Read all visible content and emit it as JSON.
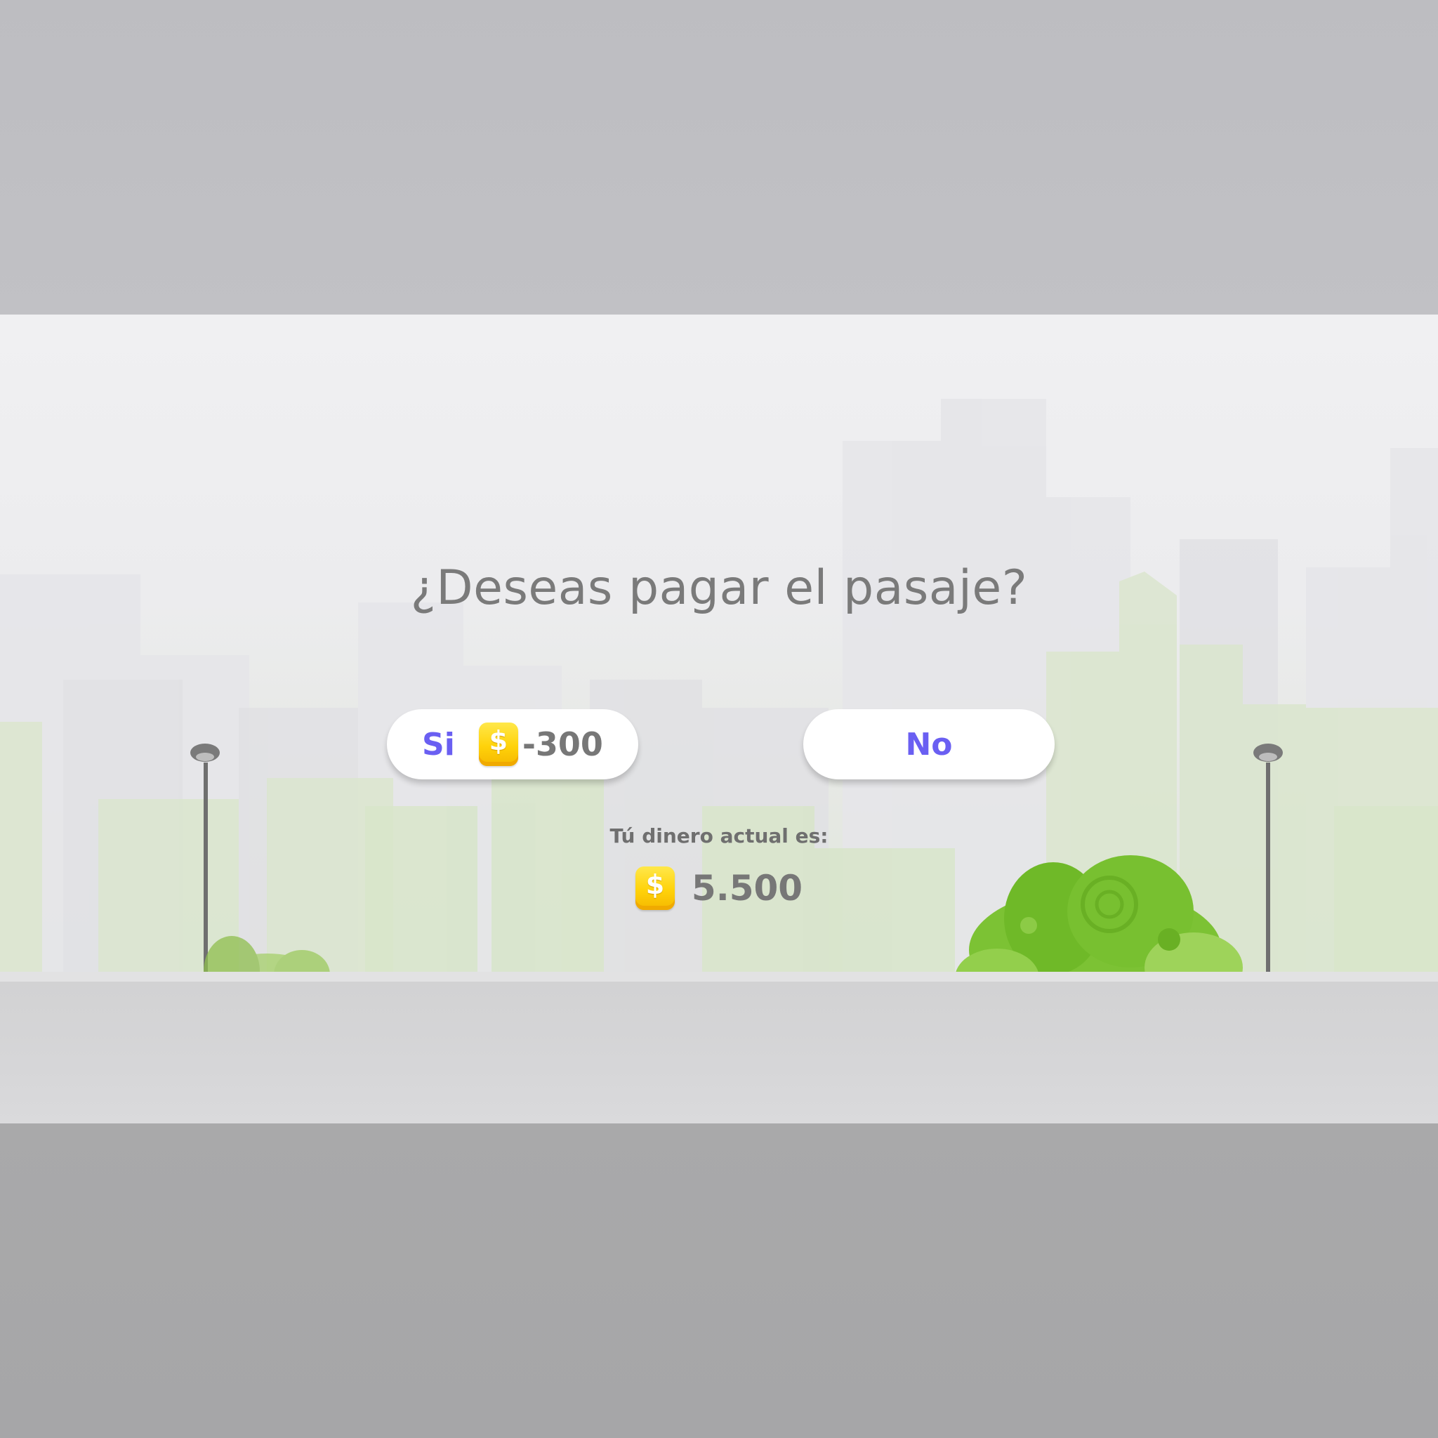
{
  "dialog": {
    "question": "¿Deseas pagar el pasaje?",
    "yes_label": "Si",
    "yes_cost": "-300",
    "no_label": "No",
    "money_label": "Tú dinero actual es:",
    "money_value": "5.500"
  },
  "icons": {
    "coin_symbol": "$",
    "coin_icon": "dollar-coin-icon"
  },
  "colors": {
    "accent": "#6a5ff2",
    "coin": "#ffd20a",
    "text_gray": "#7a7a7a",
    "bush_green": "#7cc234"
  }
}
